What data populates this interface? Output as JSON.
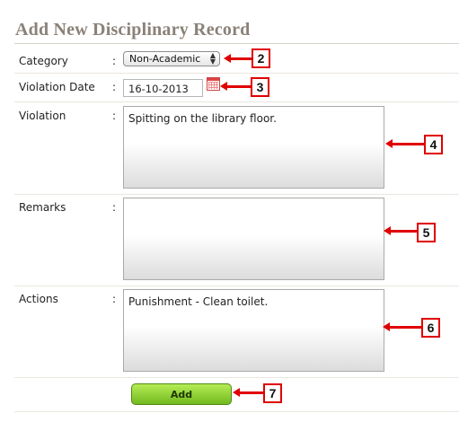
{
  "form": {
    "title": "Add New Disciplinary Record",
    "colon": ":",
    "category": {
      "label": "Category",
      "value": "Non-Academic"
    },
    "violation_date": {
      "label": "Violation Date",
      "value": "16-10-2013"
    },
    "violation": {
      "label": "Violation",
      "value": "Spitting on the library floor."
    },
    "remarks": {
      "label": "Remarks",
      "value": ""
    },
    "actions": {
      "label": "Actions",
      "value": "Punishment - Clean toilet."
    },
    "add_label": "Add"
  },
  "markers": [
    "2",
    "3",
    "4",
    "5",
    "6",
    "7"
  ],
  "colors": {
    "title": "#8a8178",
    "marker": "#e00000",
    "button": "#71b91f"
  }
}
